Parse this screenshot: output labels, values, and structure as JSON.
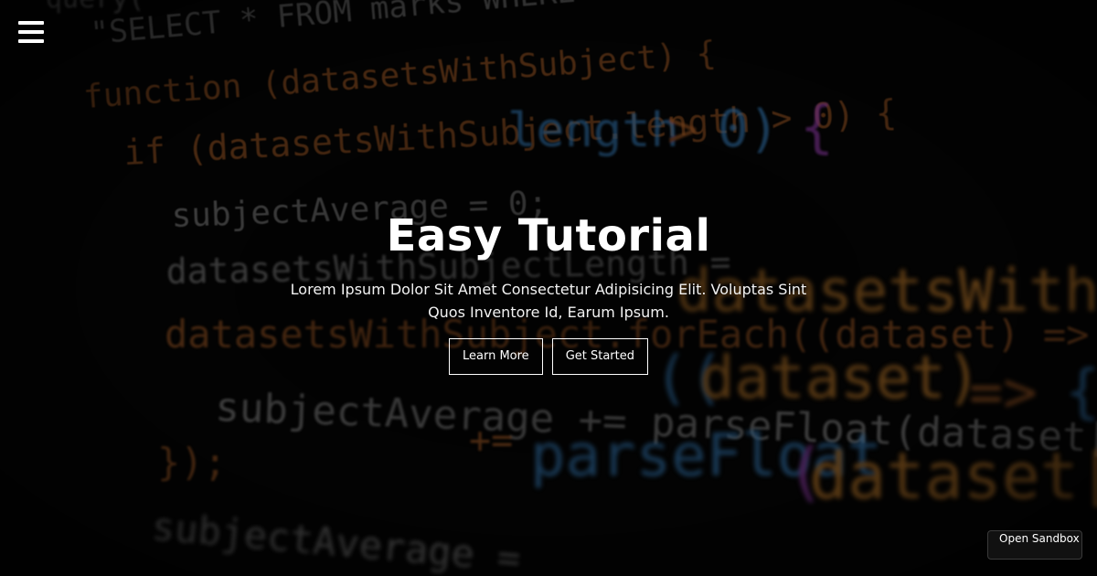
{
  "background": {
    "code_lines": [
      "query(",
      "\"SELECT * FROM marks WHERE",
      "function (datasetsWithSubject) {",
      "if (datasetsWithSubject.length > 0) {",
      "subjectAverage = 0;",
      "datasetsWithSubjectLength =",
      "datasetsWithSubject.forEach((dataset) => {",
      "subjectAverage += parseFloat(dataset[",
      "});",
      "subjectAverage ="
    ]
  },
  "nav": {
    "menu_icon": "hamburger-menu-icon"
  },
  "hero": {
    "title": "Easy Tutorial",
    "subtitle": "Lorem Ipsum Dolor Sit Amet Consectetur Adipisicing Elit. Voluptas Sint Quos Inventore Id, Earum Ipsum.",
    "buttons": {
      "learn_more": "Learn More",
      "get_started": "Get Started"
    }
  },
  "sandbox": {
    "label": "Open Sandbox"
  },
  "colors": {
    "orange": "#d1862f",
    "blue": "#3a86c8",
    "purple": "#9b3fb5",
    "gray": "#9a9a9a",
    "dark_orange": "#b5652a"
  }
}
